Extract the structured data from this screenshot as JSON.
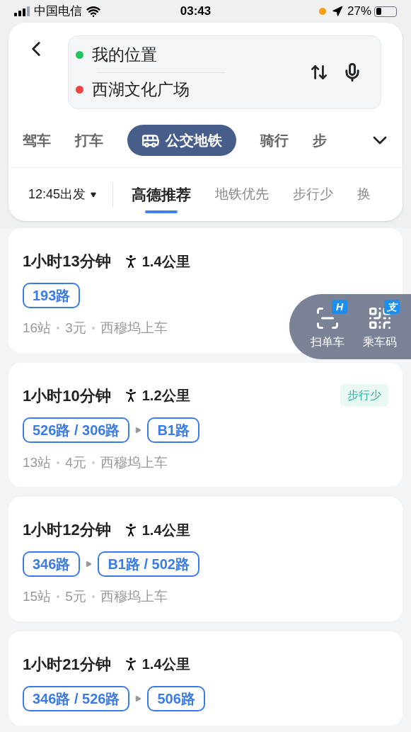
{
  "status_bar": {
    "carrier": "中国电信",
    "time": "03:43",
    "battery": "27%"
  },
  "search": {
    "origin": "我的位置",
    "destination": "西湖文化广场"
  },
  "modes": [
    {
      "label": "驾车",
      "selected": false
    },
    {
      "label": "打车",
      "selected": false
    },
    {
      "label": "公交地铁",
      "selected": true
    },
    {
      "label": "骑行",
      "selected": false
    },
    {
      "label": "步",
      "selected": false
    }
  ],
  "departure": "12:45出发",
  "sort_tabs": [
    {
      "label": "高德推荐",
      "selected": true
    },
    {
      "label": "地铁优先",
      "selected": false
    },
    {
      "label": "步行少",
      "selected": false
    },
    {
      "label": "换",
      "selected": false
    }
  ],
  "routes": [
    {
      "duration": "1小时13分钟",
      "walk": "1.4公里",
      "lines": [
        "193路"
      ],
      "info": [
        "16站",
        "3元",
        "西穆坞上车"
      ]
    },
    {
      "duration": "1小时10分钟",
      "walk": "1.2公里",
      "tag": "步行少",
      "lines": [
        "526路 / 306路",
        "B1路"
      ],
      "info": [
        "13站",
        "4元",
        "西穆坞上车"
      ]
    },
    {
      "duration": "1小时12分钟",
      "walk": "1.4公里",
      "lines": [
        "346路",
        "B1路 / 502路"
      ],
      "info": [
        "15站",
        "5元",
        "西穆坞上车"
      ]
    },
    {
      "duration": "1小时21分钟",
      "walk": "1.4公里",
      "lines": [
        "346路 / 526路",
        "506路"
      ]
    }
  ],
  "float_panel": [
    {
      "label": "扫单车",
      "badge": "H"
    },
    {
      "label": "乘车码",
      "badge": "支"
    }
  ]
}
